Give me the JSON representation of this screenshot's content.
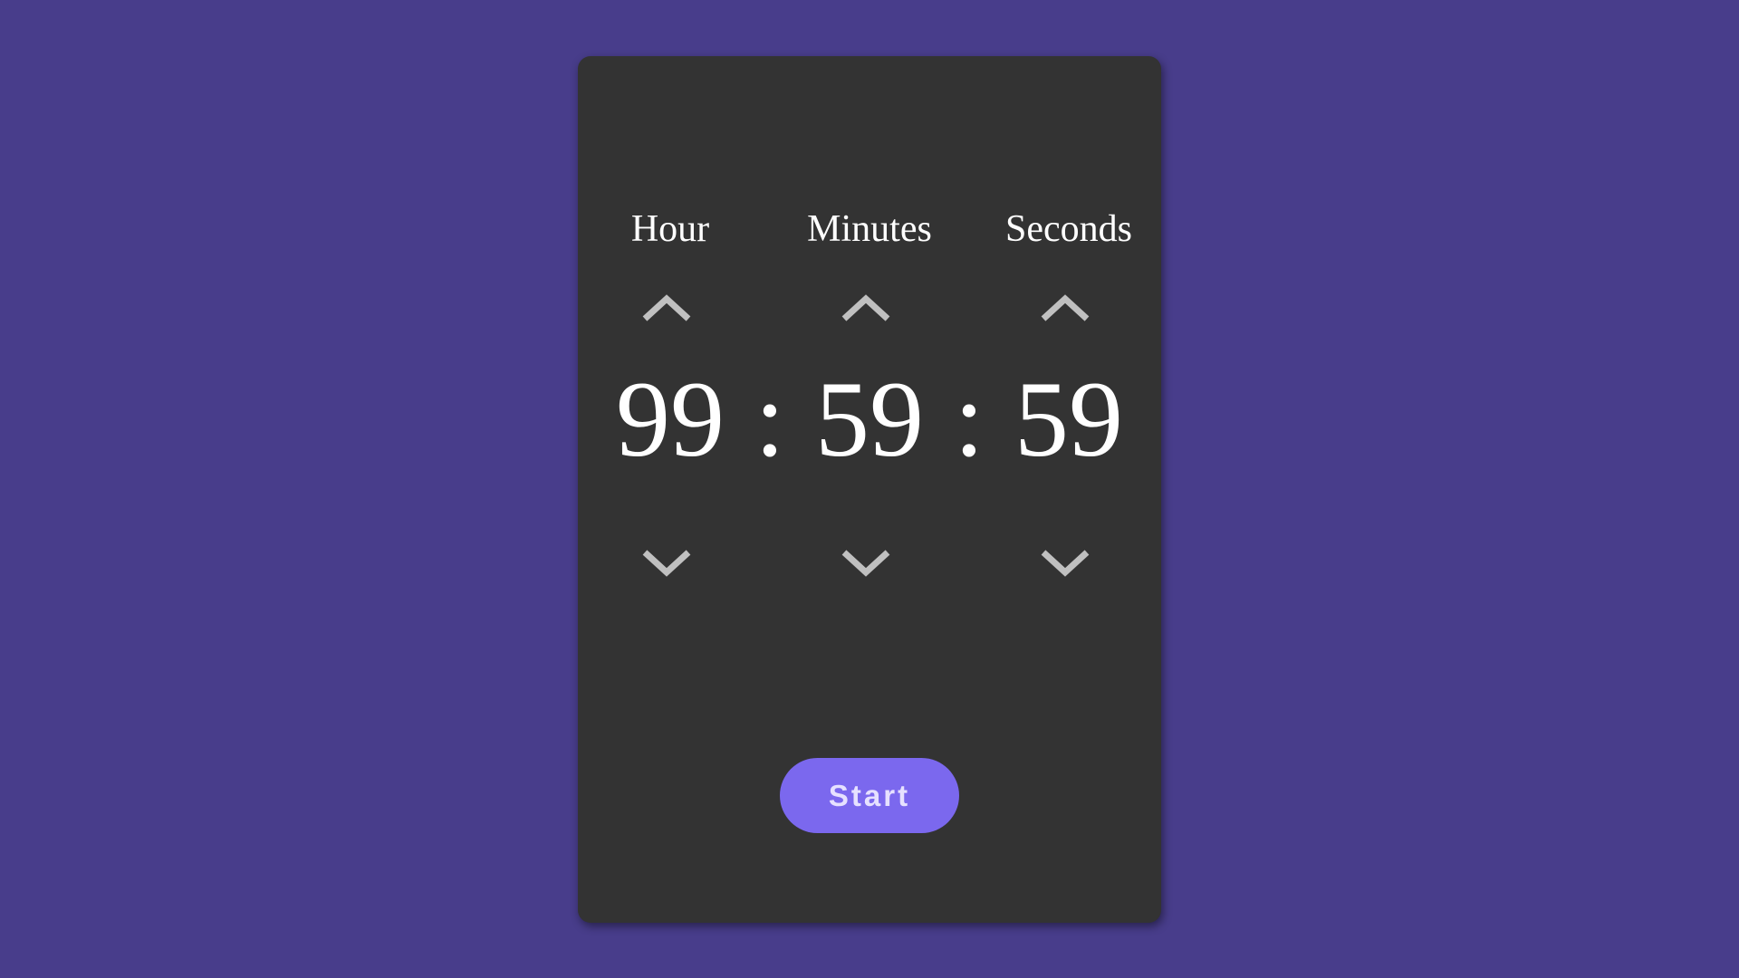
{
  "colors": {
    "background": "#483d8b",
    "card": "#333333",
    "accent": "#7b68ee",
    "chevron": "#c0c0c0"
  },
  "timer": {
    "labels": {
      "hour": "Hour",
      "minutes": "Minutes",
      "seconds": "Seconds"
    },
    "values": {
      "hours": "99",
      "minutes": "59",
      "seconds": "59"
    },
    "separator": ":",
    "icons": {
      "increment": "chevron-up-icon",
      "decrement": "chevron-down-icon"
    }
  },
  "actions": {
    "start_label": "Start"
  }
}
